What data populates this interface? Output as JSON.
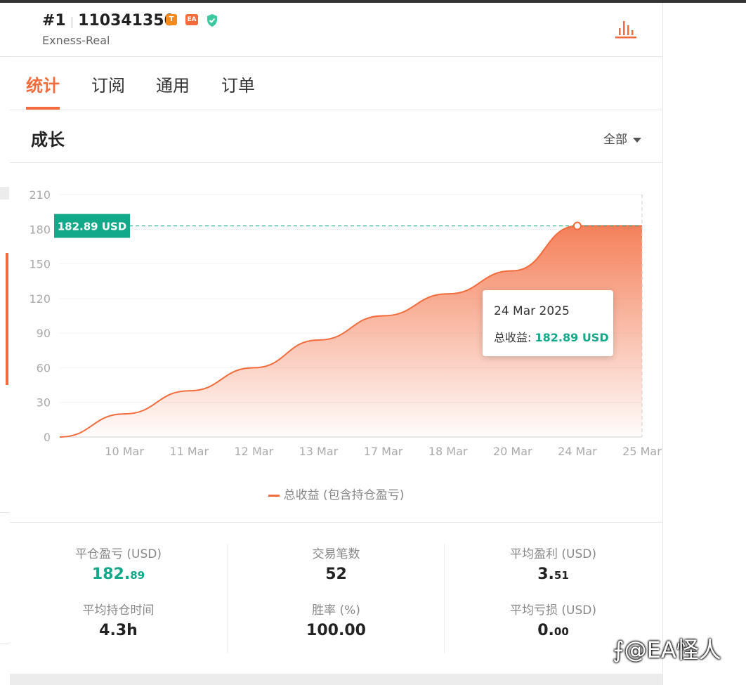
{
  "account": {
    "rank": "#1",
    "number": "110341350",
    "server": "Exness-Real",
    "badges": [
      "T",
      "EA"
    ]
  },
  "tabs": [
    "统计",
    "订阅",
    "通用",
    "订单"
  ],
  "active_tab": "统计",
  "section": {
    "title": "成长",
    "range": "全部"
  },
  "current_label": "182.89 USD",
  "tooltip": {
    "date": "24 Mar 2025",
    "label": "总收益:",
    "value": "182.89 USD"
  },
  "legend": "总收益 (包含持仓盈亏)",
  "stats": {
    "closed_pl": {
      "label": "平仓盈亏 (USD)",
      "int": "182.",
      "dec": "89"
    },
    "trades": {
      "label": "交易笔数",
      "value": "52"
    },
    "avg_profit": {
      "label": "平均盈利 (USD)",
      "int": "3.",
      "dec": "51"
    },
    "avg_hold": {
      "label": "平均持仓时间",
      "value": "4.3h"
    },
    "win_rate": {
      "label": "胜率 (%)",
      "value": "100.00"
    },
    "avg_loss": {
      "label": "平均亏损 (USD)",
      "int": "0.",
      "dec": "00"
    }
  },
  "watermark": "@EA怪人",
  "colors": {
    "accent": "#f26b3a",
    "green": "#12a88a"
  },
  "chart_data": {
    "type": "area",
    "categories": [
      "",
      "10 Mar",
      "11 Mar",
      "12 Mar",
      "13 Mar",
      "17 Mar",
      "18 Mar",
      "20 Mar",
      "24 Mar",
      "25 Mar"
    ],
    "yticks": [
      0,
      30,
      60,
      90,
      120,
      150,
      180,
      210
    ],
    "ylim": [
      0,
      210
    ],
    "series": [
      {
        "name": "总收益 (包含持仓盈亏)",
        "values": [
          0,
          20,
          40,
          60,
          84,
          105,
          124,
          144,
          182.89,
          182.89
        ]
      }
    ],
    "current_value": 182.89,
    "grid": true,
    "legend": "bottom"
  }
}
